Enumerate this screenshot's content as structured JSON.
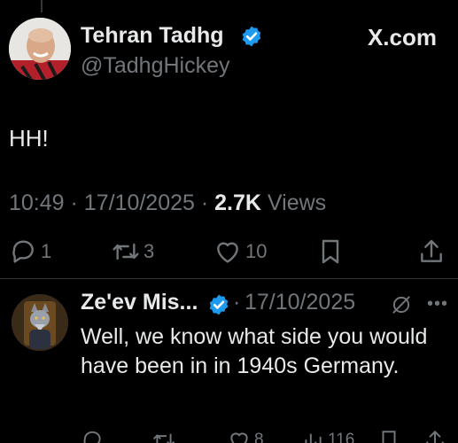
{
  "tweet": {
    "author": {
      "name": "Tehran Tadhg",
      "handle": "@TadhgHickey",
      "verified": true,
      "avatar_icon": "profile-photo-icon"
    },
    "site_label": "X.com",
    "text": "HH!",
    "time": "10:49",
    "date": "17/10/2025",
    "views_count": "2.7K",
    "views_label": "Views",
    "actions": {
      "replies": "1",
      "reposts": "3",
      "likes": "10"
    }
  },
  "reply": {
    "author": {
      "name": "Ze'ev Mis...",
      "verified": true,
      "avatar_icon": "wolf-avatar-icon"
    },
    "separator": "·",
    "date": "17/10/2025",
    "text": "Well, we know what side you would have been in in 1940s Germany.",
    "actions": {
      "likes": "8",
      "views": "116"
    }
  },
  "colors": {
    "background": "#000000",
    "primary_text": "#e7e9ea",
    "secondary_text": "#71767b",
    "verified_blue": "#1d9bf0",
    "divider": "#2f3336"
  }
}
